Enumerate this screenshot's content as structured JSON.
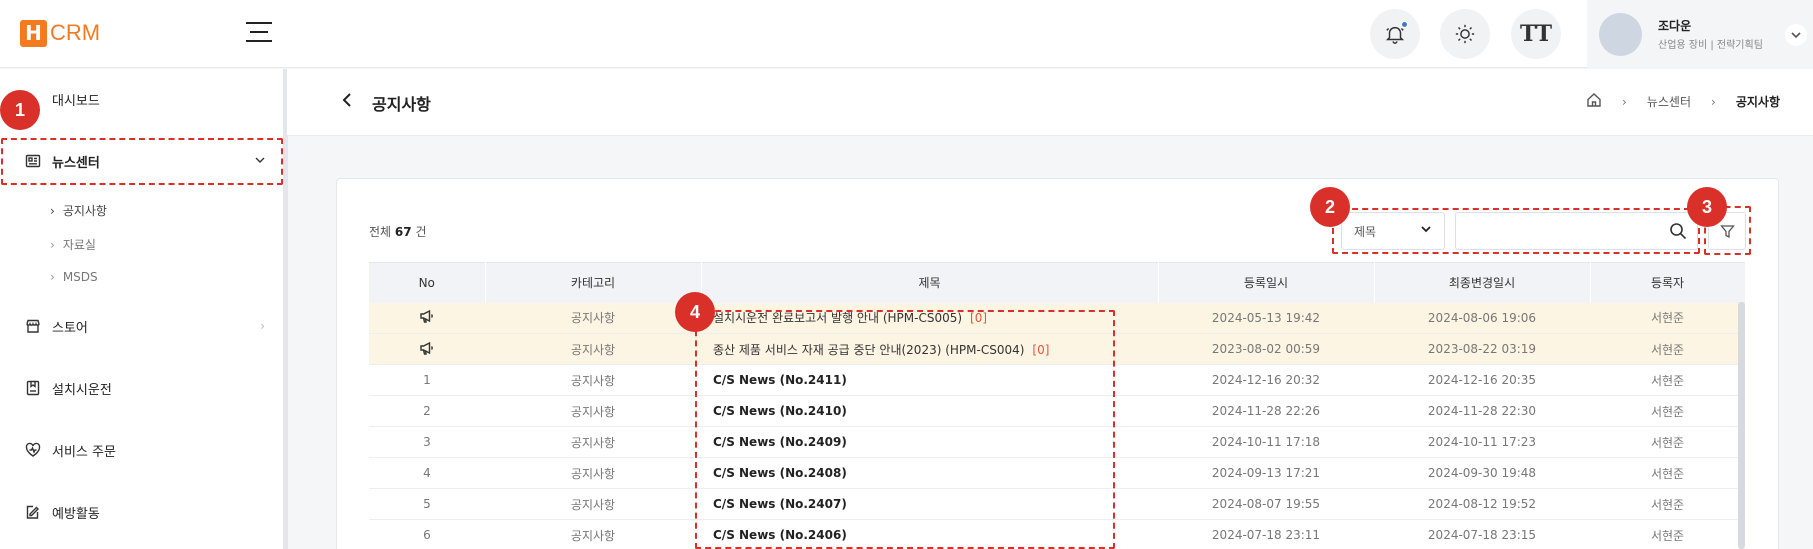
{
  "app": {
    "logo_letter": "H",
    "logo_text": "CRM",
    "brand_color": "#f47a20"
  },
  "header": {
    "user_name": "조다운",
    "user_org": "산업용 장비 | 전략기획팀",
    "font_button_label": "TT",
    "icons": [
      "menu-icon",
      "bell-icon",
      "sun-icon",
      "font-size-icon",
      "chevron-down-icon"
    ]
  },
  "sidebar": {
    "items": [
      {
        "label": "대시보드",
        "icon": "dashboard-icon"
      },
      {
        "label": "뉴스센터",
        "icon": "news-icon",
        "expanded": true
      },
      {
        "label": "스토어",
        "icon": "store-icon"
      },
      {
        "label": "설치시운전",
        "icon": "install-icon"
      },
      {
        "label": "서비스 주문",
        "icon": "service-order-icon"
      },
      {
        "label": "예방활동",
        "icon": "prevention-icon"
      }
    ],
    "subitems": [
      "공지사항",
      "자료실",
      "MSDS"
    ]
  },
  "page": {
    "title": "공지사항",
    "breadcrumb": [
      "뉴스센터",
      "공지사항"
    ]
  },
  "list": {
    "total_prefix": "전체",
    "total_count": "67",
    "total_suffix": "건",
    "search_select": "제목",
    "search_value": "",
    "columns": [
      "No",
      "카테고리",
      "제목",
      "등록일시",
      "최종변경일시",
      "등록자"
    ],
    "rows": [
      {
        "no": "",
        "pinned": true,
        "category": "공지사항",
        "title": "설치시운전 완료보고서 발행 안내 (HPM-CS005)",
        "comments": "[0]",
        "created": "2024-05-13 19:42",
        "modified": "2024-08-06 19:06",
        "author": "서현준"
      },
      {
        "no": "",
        "pinned": true,
        "category": "공지사항",
        "title": "종산 제품 서비스 자재 공급 중단 안내(2023) (HPM-CS004)",
        "comments": "[0]",
        "created": "2023-08-02 00:59",
        "modified": "2023-08-22 03:19",
        "author": "서현준"
      },
      {
        "no": "1",
        "pinned": false,
        "category": "공지사항",
        "title": "C/S News (No.2411)",
        "comments": "",
        "created": "2024-12-16 20:32",
        "modified": "2024-12-16 20:35",
        "author": "서현준"
      },
      {
        "no": "2",
        "pinned": false,
        "category": "공지사항",
        "title": "C/S News (No.2410)",
        "comments": "",
        "created": "2024-11-28 22:26",
        "modified": "2024-11-28 22:30",
        "author": "서현준"
      },
      {
        "no": "3",
        "pinned": false,
        "category": "공지사항",
        "title": "C/S News (No.2409)",
        "comments": "",
        "created": "2024-10-11 17:18",
        "modified": "2024-10-11 17:23",
        "author": "서현준"
      },
      {
        "no": "4",
        "pinned": false,
        "category": "공지사항",
        "title": "C/S News (No.2408)",
        "comments": "",
        "created": "2024-09-13 17:21",
        "modified": "2024-09-30 19:48",
        "author": "서현준"
      },
      {
        "no": "5",
        "pinned": false,
        "category": "공지사항",
        "title": "C/S News (No.2407)",
        "comments": "",
        "created": "2024-08-07 19:55",
        "modified": "2024-08-12 19:52",
        "author": "서현준"
      },
      {
        "no": "6",
        "pinned": false,
        "category": "공지사항",
        "title": "C/S News (No.2406)",
        "comments": "",
        "created": "2024-07-18 23:11",
        "modified": "2024-07-18 23:15",
        "author": "서현준"
      }
    ]
  },
  "annotations": {
    "color": "#d9302a",
    "labels": [
      "1",
      "2",
      "3",
      "4"
    ]
  }
}
